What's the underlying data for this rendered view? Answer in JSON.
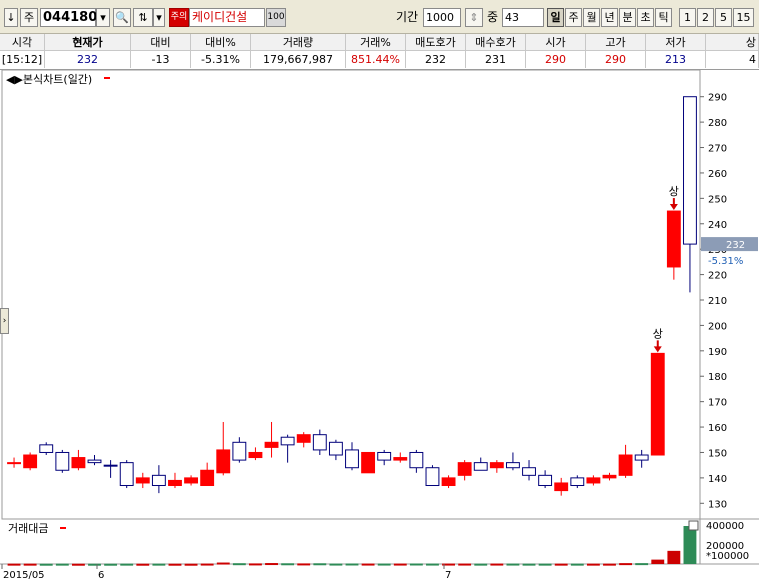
{
  "toolbar": {
    "arrow_icon": "down-arrow-icon",
    "market_label": "주",
    "code": "044180",
    "warning_badge": "주의",
    "stock_name": "케이디건설",
    "stock_badge": "100",
    "period_label": "기간",
    "period_value": "1000",
    "count_label": "중",
    "count_value": "43",
    "periods": [
      "일",
      "주",
      "월",
      "년",
      "분",
      "초",
      "틱",
      "1",
      "2",
      "5",
      "15"
    ],
    "active_period": "일"
  },
  "quote": {
    "headers": [
      "시각",
      "현재가",
      "대비",
      "대비%",
      "거래량",
      "거래%",
      "매도호가",
      "매수호가",
      "시가",
      "고가",
      "저가",
      "상"
    ],
    "values": [
      "[15:12]",
      "232",
      "-13",
      "-5.31%",
      "179,667,987",
      "851.44%",
      "232",
      "231",
      "290",
      "290",
      "213",
      "4"
    ],
    "colors": {
      "up": "#d40000",
      "down": "#00008b",
      "neutral": "#000000"
    }
  },
  "chart": {
    "title": "◀▶본식차트(일간)",
    "volume_title": "거래대금",
    "current_price_label": "232",
    "current_change_label": "-5.31%",
    "upper_limit_marker": "상",
    "volume_axis_labels": [
      "400000",
      "200000",
      "*100000"
    ],
    "x_labels": [
      "2015/05",
      "6",
      "7"
    ],
    "colors": {
      "up": "#ff0000",
      "down": "#ffffff",
      "down_stroke": "#00007a",
      "volume_up": "#cc0000",
      "volume_down": "#2e8b57",
      "marker": "#d40000"
    }
  },
  "chart_data": {
    "type": "candlestick",
    "title": "",
    "ylim": [
      125,
      295
    ],
    "y_ticks": [
      130,
      140,
      150,
      160,
      170,
      180,
      190,
      200,
      210,
      220,
      230,
      240,
      250,
      260,
      270,
      280,
      290
    ],
    "candles": [
      {
        "o": 146,
        "h": 148,
        "l": 144,
        "c": 146,
        "up": true
      },
      {
        "o": 144,
        "h": 150,
        "l": 143,
        "c": 149,
        "up": true
      },
      {
        "o": 150,
        "h": 154,
        "l": 149,
        "c": 153,
        "up": false
      },
      {
        "o": 150,
        "h": 151,
        "l": 142,
        "c": 143,
        "up": false
      },
      {
        "o": 144,
        "h": 151,
        "l": 143,
        "c": 148,
        "up": true
      },
      {
        "o": 147,
        "h": 149,
        "l": 145,
        "c": 146,
        "up": false
      },
      {
        "o": 145,
        "h": 147,
        "l": 140,
        "c": 145,
        "up": false
      },
      {
        "o": 146,
        "h": 147,
        "l": 136,
        "c": 137,
        "up": false
      },
      {
        "o": 138,
        "h": 142,
        "l": 136,
        "c": 140,
        "up": true
      },
      {
        "o": 141,
        "h": 145,
        "l": 134,
        "c": 137,
        "up": false
      },
      {
        "o": 137,
        "h": 142,
        "l": 136,
        "c": 139,
        "up": true
      },
      {
        "o": 138,
        "h": 141,
        "l": 137,
        "c": 140,
        "up": true
      },
      {
        "o": 137,
        "h": 146,
        "l": 137,
        "c": 143,
        "up": true
      },
      {
        "o": 142,
        "h": 162,
        "l": 141,
        "c": 151,
        "up": true
      },
      {
        "o": 147,
        "h": 156,
        "l": 146,
        "c": 154,
        "up": false
      },
      {
        "o": 148,
        "h": 152,
        "l": 147,
        "c": 150,
        "up": true
      },
      {
        "o": 152,
        "h": 162,
        "l": 148,
        "c": 154,
        "up": true
      },
      {
        "o": 153,
        "h": 157,
        "l": 146,
        "c": 156,
        "up": false
      },
      {
        "o": 154,
        "h": 158,
        "l": 152,
        "c": 157,
        "up": true
      },
      {
        "o": 157,
        "h": 159,
        "l": 149,
        "c": 151,
        "up": false
      },
      {
        "o": 154,
        "h": 155,
        "l": 147,
        "c": 149,
        "up": false
      },
      {
        "o": 151,
        "h": 154,
        "l": 143,
        "c": 144,
        "up": false
      },
      {
        "o": 142,
        "h": 150,
        "l": 142,
        "c": 150,
        "up": true
      },
      {
        "o": 150,
        "h": 151,
        "l": 145,
        "c": 147,
        "up": false
      },
      {
        "o": 147,
        "h": 150,
        "l": 146,
        "c": 148,
        "up": true
      },
      {
        "o": 150,
        "h": 151,
        "l": 142,
        "c": 144,
        "up": false
      },
      {
        "o": 144,
        "h": 145,
        "l": 137,
        "c": 137,
        "up": false
      },
      {
        "o": 137,
        "h": 141,
        "l": 136,
        "c": 140,
        "up": true
      },
      {
        "o": 141,
        "h": 147,
        "l": 139,
        "c": 146,
        "up": true
      },
      {
        "o": 146,
        "h": 148,
        "l": 143,
        "c": 143,
        "up": false
      },
      {
        "o": 144,
        "h": 147,
        "l": 142,
        "c": 146,
        "up": true
      },
      {
        "o": 146,
        "h": 150,
        "l": 143,
        "c": 144,
        "up": false
      },
      {
        "o": 144,
        "h": 147,
        "l": 139,
        "c": 141,
        "up": false
      },
      {
        "o": 141,
        "h": 143,
        "l": 136,
        "c": 137,
        "up": false
      },
      {
        "o": 135,
        "h": 140,
        "l": 133,
        "c": 138,
        "up": true
      },
      {
        "o": 137,
        "h": 141,
        "l": 136,
        "c": 140,
        "up": false
      },
      {
        "o": 138,
        "h": 141,
        "l": 137,
        "c": 140,
        "up": true
      },
      {
        "o": 140,
        "h": 142,
        "l": 139,
        "c": 141,
        "up": true
      },
      {
        "o": 141,
        "h": 153,
        "l": 140,
        "c": 149,
        "up": true
      },
      {
        "o": 149,
        "h": 151,
        "l": 144,
        "c": 147,
        "up": false
      },
      {
        "o": 149,
        "h": 189,
        "l": 149,
        "c": 189,
        "up": true
      },
      {
        "o": 223,
        "h": 245,
        "l": 218,
        "c": 245,
        "up": true
      },
      {
        "o": 290,
        "h": 290,
        "l": 213,
        "c": 232,
        "up": false
      }
    ],
    "upper_limit_days": [
      40,
      41
    ],
    "volume": [
      5000,
      5000,
      4000,
      5000,
      4000,
      4000,
      4000,
      5000,
      4000,
      5000,
      4000,
      4000,
      6000,
      20000,
      11000,
      8000,
      13000,
      10000,
      8000,
      10000,
      6000,
      7000,
      6000,
      6000,
      6000,
      7000,
      6000,
      6000,
      6000,
      5000,
      6000,
      6000,
      5000,
      5000,
      5000,
      5000,
      5000,
      5000,
      12000,
      12000,
      60000,
      180000,
      520000
    ]
  }
}
